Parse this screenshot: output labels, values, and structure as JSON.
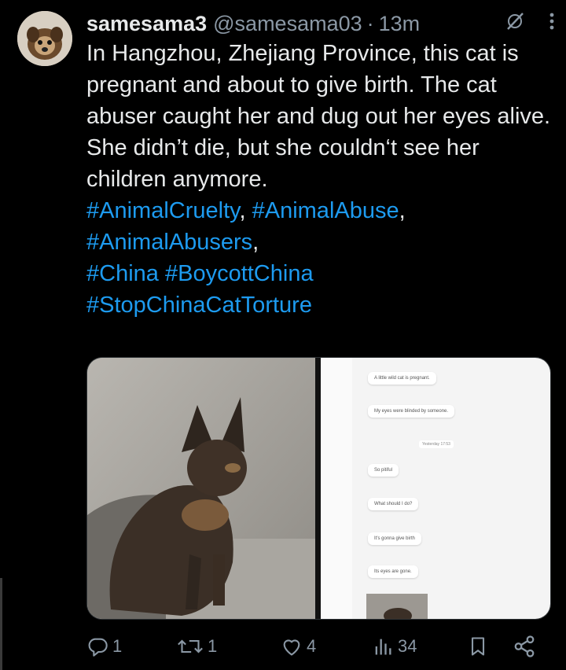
{
  "tweet": {
    "display_name": "samesama3",
    "handle": "@samesama03",
    "separator": "·",
    "time": "13m",
    "paragraphs": [
      "In Hangzhou, Zhejiang Province, this cat is pregnant and about to give birth. The cat abuser caught her and dug out her eyes alive.",
      "She didn’t die, but she couldn‘t see her children anymore."
    ],
    "hashtags": {
      "animal_cruelty": "#AnimalCruelty",
      "animal_abuse": "#AnimalAbuse",
      "animal_abusers": "#AnimalAbusers",
      "china": "#China",
      "boycott_china": "#BoycottChina",
      "stop_china": "#StopChinaCatTorture"
    },
    "comma": ","
  },
  "media": {
    "chat_bubbles": [
      "A little wild cat is pregnant.",
      "My eyes were blinded by someone.",
      "So pitiful",
      "What should I do?",
      "It's gonna give birth",
      "Its eyes are gone."
    ],
    "chat_timestamp": "Yesterday 17:53"
  },
  "actions": {
    "replies": "1",
    "reposts": "1",
    "likes": "4",
    "views": "34"
  },
  "icons": {
    "reply": "reply-icon",
    "repost": "repost-icon",
    "like": "heart-icon",
    "views": "views-icon",
    "bookmark": "bookmark-icon",
    "share": "share-icon",
    "more": "more-icon",
    "grok": "grok-icon"
  },
  "colors": {
    "background": "#000000",
    "text": "#e7e9ea",
    "secondary": "#8b98a5",
    "link": "#1d9bf0"
  }
}
